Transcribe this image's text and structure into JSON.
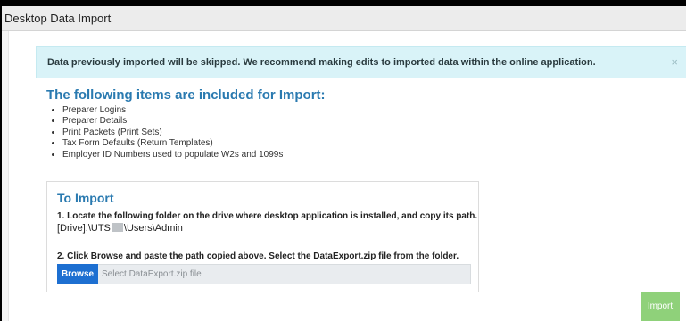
{
  "window": {
    "title": "Desktop Data Import"
  },
  "alert": {
    "text": "Data previously imported will be skipped. We recommend making edits to imported data within the online application.",
    "close_label": "×"
  },
  "items_section": {
    "title": "The following items are included for Import:",
    "items": [
      "Preparer Logins",
      "Preparer Details",
      "Print Packets (Print Sets)",
      "Tax Form Defaults (Return Templates)",
      "Employer ID Numbers used to populate W2s and 1099s"
    ]
  },
  "import_panel": {
    "title": "To Import",
    "step1": "1. Locate the following folder on the drive where desktop application is installed, and copy its path.",
    "path_prefix": "[Drive]:\\UTS",
    "path_suffix": "\\Users\\Admin",
    "step2": "2. Click Browse and paste the path copied above. Select the DataExport.zip file from the folder.",
    "browse_label": "Browse",
    "file_placeholder": "Select DataExport.zip file"
  },
  "footer": {
    "import_label": "Import"
  },
  "colors": {
    "accent_blue": "#2a7ab0",
    "browse_blue": "#1d6fd1",
    "import_green": "#8fd17a",
    "alert_bg": "#d9f3f8"
  }
}
